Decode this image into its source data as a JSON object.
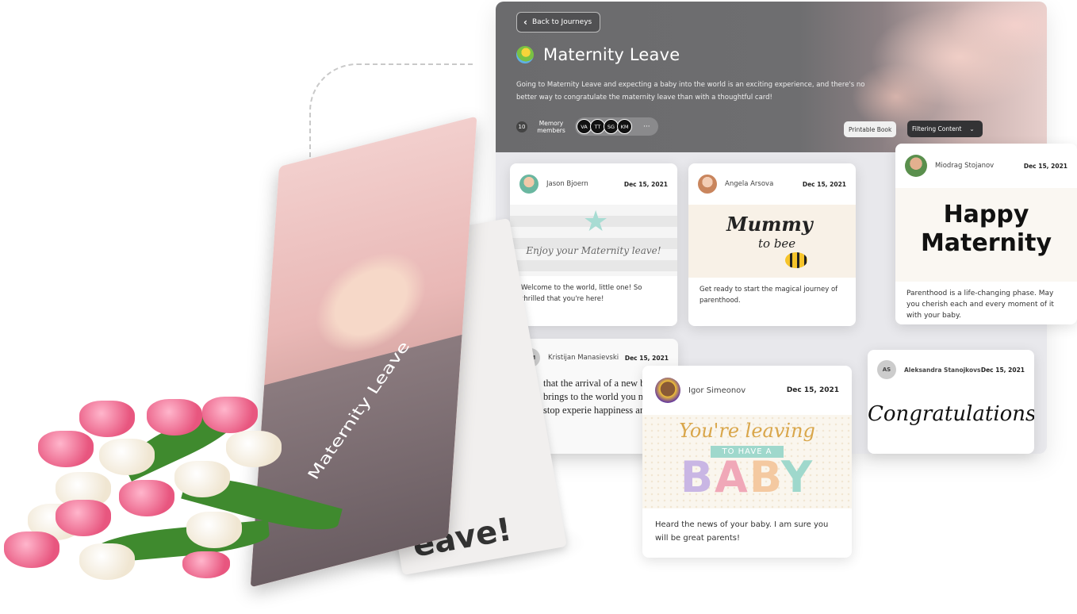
{
  "header": {
    "back_label": "Back to Journeys",
    "title": "Maternity Leave",
    "description": "Going to Maternity Leave and expecting a baby into the world is an exciting experience, and there's no better way to congratulate the maternity leave than with a thoughtful card!",
    "members_count": "10",
    "members_label": "Memory members",
    "member_initials": [
      "VA",
      "TT",
      "SG",
      "KM"
    ],
    "more_label": "···",
    "printable_book_label": "Printable Book",
    "filtering_label": "Filtering Content"
  },
  "cards": [
    {
      "name": "Jason Bjoern",
      "date": "Dec 15, 2021",
      "message": "Welcome to the world, little one! So thrilled that you're here!",
      "image_text": "Enjoy your Maternity leave!"
    },
    {
      "name": "Angela Arsova",
      "date": "Dec 15, 2021",
      "message": "Get ready to start the magical journey of parenthood.",
      "image_text_1": "Mummy",
      "image_text_2": "to bee"
    },
    {
      "name": "Miodrag Stojanov",
      "date": "Dec 15, 2021",
      "message": "Parenthood is a life-changing phase. May you cherish each and every moment of it with your baby.",
      "image_text_1": "Happy",
      "image_text_2": "Maternity"
    },
    {
      "initials": "KM",
      "name": "Kristijan Manasievski",
      "date": "Dec 15, 2021",
      "message": "that the arrival of a new boy brings to the world you never stop experie happiness and joy"
    },
    {
      "name": "Igor Simeonov",
      "date": "Dec 15, 2021",
      "message": "Heard the news of your baby. I am sure you will be great parents!",
      "image_text_1": "You're leaving",
      "image_text_2": "TO HAVE A",
      "image_text_3": [
        "B",
        "A",
        "B",
        "Y"
      ]
    },
    {
      "initials": "AS",
      "name": "Aleksandra Stanojkovska",
      "date": "Dec 15, 2021",
      "image_text": "Congratulations!"
    }
  ],
  "book": {
    "cover_title": "Maternity Leave",
    "inner_text": "eave!"
  },
  "colors": {
    "hero_gray": "#6b6b6d",
    "accent_teal": "#9fd8cc",
    "tulip_pink": "#e8567f"
  },
  "icons": [
    "chevron-left-icon",
    "pacifier-icon",
    "chevron-down-icon"
  ]
}
